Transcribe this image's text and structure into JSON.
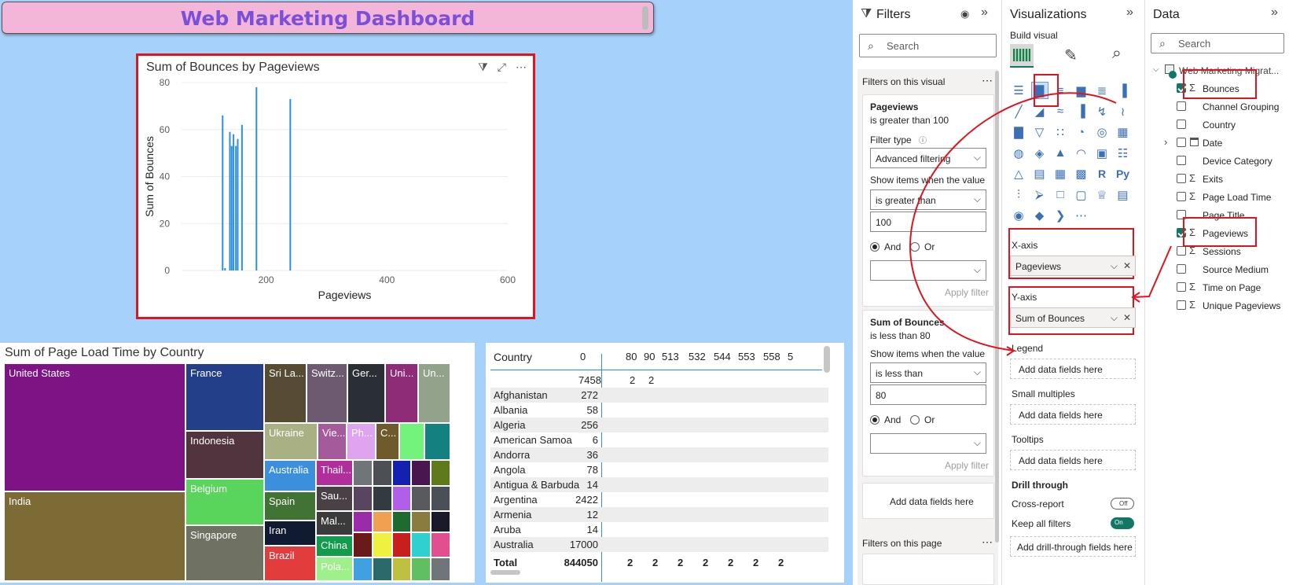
{
  "dashboard_title": "Web Marketing Dashboard",
  "chart1": {
    "title": "Sum of Bounces by Pageviews",
    "xlabel": "Pageviews",
    "ylabel": "Sum of Bounces",
    "x_ticks": [
      "200",
      "400",
      "600"
    ],
    "y_ticks": [
      "0",
      "20",
      "40",
      "60",
      "80"
    ],
    "icons": [
      "filter-icon",
      "focus-mode-icon",
      "more-options-icon"
    ]
  },
  "chart_data": {
    "type": "bar",
    "title": "Sum of Bounces by Pageviews",
    "xlabel": "Pageviews",
    "ylabel": "Sum of Bounces",
    "xlim": [
      60,
      600
    ],
    "ylim": [
      0,
      80
    ],
    "x": [
      128,
      132,
      140,
      143,
      146,
      150,
      153,
      160,
      184,
      240
    ],
    "values": [
      66,
      1,
      59,
      53,
      58,
      53,
      56,
      62,
      78,
      73
    ],
    "color": "#2b8fe6"
  },
  "treemap": {
    "title": "Sum of Page Load Time by Country",
    "tiles": [
      {
        "label": "United States",
        "color": "#7e1386"
      },
      {
        "label": "India",
        "color": "#7d6b35"
      },
      {
        "label": "France",
        "color": "#233f8a"
      },
      {
        "label": "Indonesia",
        "color": "#51343e"
      },
      {
        "label": "Belgium",
        "color": "#5ad55c"
      },
      {
        "label": "Singapore",
        "color": "#6f7262"
      },
      {
        "label": "Sri La...",
        "color": "#574b34"
      },
      {
        "label": "Switz...",
        "color": "#6d5a70"
      },
      {
        "label": "Ger...",
        "color": "#2a2f36"
      },
      {
        "label": "Uni...",
        "color": "#8e2c78"
      },
      {
        "label": "Un...",
        "color": "#93a38b"
      },
      {
        "label": "Ukraine",
        "color": "#a9b184"
      },
      {
        "label": "Vie...",
        "color": "#a55a9c"
      },
      {
        "label": "Ph...",
        "color": "#dfa4f0"
      },
      {
        "label": "C...",
        "color": "#6e5a2b"
      },
      {
        "label": "",
        "color": "#74f37c"
      },
      {
        "label": "",
        "color": "#158080"
      },
      {
        "label": "Australia",
        "color": "#3b8fdd"
      },
      {
        "label": "Thail...",
        "color": "#b02f9a"
      },
      {
        "label": "Spain",
        "color": "#417334"
      },
      {
        "label": "Sau...",
        "color": "#4a4146"
      },
      {
        "label": "Iran",
        "color": "#101a30"
      },
      {
        "label": "Mal...",
        "color": "#3b3b3b"
      },
      {
        "label": "Brazil",
        "color": "#e23c3c"
      },
      {
        "label": "China",
        "color": "#129b4a"
      },
      {
        "label": "Pola...",
        "color": "#9ef08a"
      }
    ],
    "small_colors": [
      "#6f7578",
      "#4c5055",
      "#1420b0",
      "#4a1650",
      "#5f7a1a",
      "#5a4560",
      "#333a40",
      "#b15fe8",
      "#585a5e",
      "#4a4f58",
      "#9b2ba8",
      "#f0a050",
      "#1e6a30",
      "#8a7c3e",
      "#1a1a2a",
      "#6a1a1a",
      "#f0f040",
      "#c81e1e",
      "#30d0d0",
      "#e05090",
      "#40a0e0",
      "#2a6a6a",
      "#c0c040",
      "#60c060"
    ]
  },
  "matrix": {
    "header_country": "Country",
    "header_cols": [
      "0",
      "80",
      "90",
      "513",
      "532",
      "544",
      "553",
      "558",
      "5"
    ],
    "blank_row": [
      "7458",
      "2",
      "2"
    ],
    "rows": [
      {
        "country": "Afghanistan",
        "value": "272"
      },
      {
        "country": "Albania",
        "value": "58"
      },
      {
        "country": "Algeria",
        "value": "256"
      },
      {
        "country": "American Samoa",
        "value": "6"
      },
      {
        "country": "Andorra",
        "value": "36"
      },
      {
        "country": "Angola",
        "value": "78"
      },
      {
        "country": "Antigua & Barbuda",
        "value": "14"
      },
      {
        "country": "Argentina",
        "value": "2422"
      },
      {
        "country": "Armenia",
        "value": "12"
      },
      {
        "country": "Aruba",
        "value": "14"
      },
      {
        "country": "Australia",
        "value": "17000"
      }
    ],
    "total_label": "Total",
    "total_values": [
      "844050",
      "2",
      "2",
      "2",
      "2",
      "2",
      "2",
      "2"
    ]
  },
  "filters": {
    "title": "Filters",
    "search_placeholder": "Search",
    "on_visual": "Filters on this visual",
    "card1": {
      "field": "Pageviews",
      "summary": "is greater than 100",
      "filter_type_label": "Filter type",
      "filter_type": "Advanced filtering",
      "show_items": "Show items when the value",
      "condition": "is greater than",
      "value": "100",
      "and": "And",
      "or": "Or",
      "apply": "Apply filter"
    },
    "card2": {
      "field": "Sum of Bounces",
      "summary": "is less than 80",
      "show_items": "Show items when the value",
      "condition": "is less than",
      "value": "80",
      "and": "And",
      "or": "Or",
      "apply": "Apply filter"
    },
    "add_fields": "Add data fields here",
    "on_page": "Filters on this page"
  },
  "visualizations": {
    "title": "Visualizations",
    "build_visual": "Build visual",
    "x_axis": "X-axis",
    "x_field": "Pageviews",
    "y_axis": "Y-axis",
    "y_field": "Sum of Bounces",
    "legend": "Legend",
    "small_multiples": "Small multiples",
    "tooltips": "Tooltips",
    "add_fields": "Add data fields here",
    "drill_through": "Drill through",
    "cross_report": "Cross-report",
    "cross_report_state": "Off",
    "keep_all_filters": "Keep all filters",
    "keep_all_filters_state": "On",
    "add_drill": "Add drill-through fields here"
  },
  "data": {
    "title": "Data",
    "search_placeholder": "Search",
    "table_name": "Web Marketing Migrat...",
    "fields": [
      {
        "name": "Bounces",
        "sigma": true,
        "checked": true
      },
      {
        "name": "Channel Grouping",
        "sigma": false,
        "checked": false
      },
      {
        "name": "Country",
        "sigma": false,
        "checked": false
      },
      {
        "name": "Date",
        "sigma": false,
        "checked": false
      },
      {
        "name": "Device Category",
        "sigma": false,
        "checked": false
      },
      {
        "name": "Exits",
        "sigma": true,
        "checked": false
      },
      {
        "name": "Page Load Time",
        "sigma": true,
        "checked": false
      },
      {
        "name": "Page Title",
        "sigma": false,
        "checked": false
      },
      {
        "name": "Pageviews",
        "sigma": true,
        "checked": true
      },
      {
        "name": "Sessions",
        "sigma": true,
        "checked": false
      },
      {
        "name": "Source Medium",
        "sigma": false,
        "checked": false
      },
      {
        "name": "Time on Page",
        "sigma": true,
        "checked": false
      },
      {
        "name": "Unique Pageviews",
        "sigma": true,
        "checked": false
      }
    ]
  },
  "colors": {
    "accent_red": "#e0141e",
    "bar_blue": "#2b8fe6",
    "toggle_on": "#117865"
  }
}
